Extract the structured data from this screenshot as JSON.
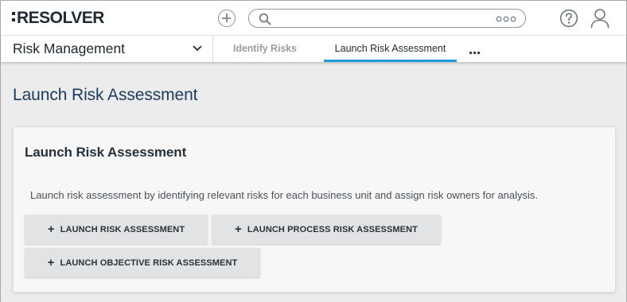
{
  "header": {
    "logo_text": "RESOLVER",
    "search": {
      "value": "",
      "placeholder": ""
    },
    "icons": {
      "add": "add-circle-icon",
      "search": "search-icon",
      "search_more": "more-horizontal-icon",
      "help": "help-icon",
      "user": "user-icon"
    }
  },
  "nav": {
    "app_selector": "Risk Management",
    "tabs": [
      {
        "label": "Identify Risks",
        "active": false
      },
      {
        "label": "Launch Risk Assessment",
        "active": true
      }
    ],
    "more_icon": "ellipsis-icon"
  },
  "page": {
    "title": "Launch Risk Assessment",
    "card": {
      "title": "Launch Risk Assessment",
      "description": "Launch risk assessment by identifying relevant risks for each business unit and assign risk owners for analysis.",
      "buttons": [
        {
          "label": "LAUNCH RISK ASSESSMENT"
        },
        {
          "label": "LAUNCH PROCESS RISK ASSESSMENT"
        },
        {
          "label": "LAUNCH OBJECTIVE RISK ASSESSMENT"
        }
      ]
    }
  },
  "colors": {
    "accent": "#1e9bd7",
    "page_title": "#1d3a5c",
    "page_background": "#ececec",
    "button_background": "#e1e3e5"
  }
}
